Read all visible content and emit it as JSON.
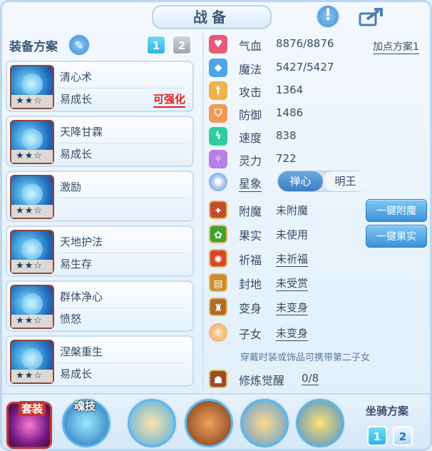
{
  "header": {
    "title": "战备"
  },
  "left": {
    "title": "装备方案",
    "plans": [
      "1",
      "2"
    ],
    "skills": [
      {
        "name": "清心术",
        "sub": "易成长",
        "tag": "可强化",
        "stars": "★★☆"
      },
      {
        "name": "天降甘霖",
        "sub": "易成长",
        "tag": "",
        "stars": "★★☆"
      },
      {
        "name": "激励",
        "sub": "",
        "tag": "",
        "stars": "★★☆"
      },
      {
        "name": "天地护法",
        "sub": "易生存",
        "tag": "",
        "stars": "★★☆"
      },
      {
        "name": "群体净心",
        "sub": "愤怒",
        "tag": "",
        "stars": "★★☆"
      },
      {
        "name": "涅槃重生",
        "sub": "易成长",
        "tag": "",
        "stars": "★★☆"
      }
    ]
  },
  "right": {
    "plan_link": "加点方案1",
    "stats": [
      {
        "label": "气血",
        "value": "8876/8876",
        "color": "#e85a7a",
        "icon": "heart-icon",
        "glyph": "♥"
      },
      {
        "label": "魔法",
        "value": "5427/5427",
        "color": "#4aa6e8",
        "icon": "mana-icon",
        "glyph": "◆"
      },
      {
        "label": "攻击",
        "value": "1364",
        "color": "#f0b34a",
        "icon": "sword-icon",
        "glyph": "†"
      },
      {
        "label": "防御",
        "value": "1486",
        "color": "#f09a5a",
        "icon": "shield-icon",
        "glyph": "⛉"
      },
      {
        "label": "速度",
        "value": "838",
        "color": "#2ccf9a",
        "icon": "speed-icon",
        "glyph": "ϟ"
      },
      {
        "label": "灵力",
        "value": "722",
        "color": "#b77fe8",
        "icon": "spirit-icon",
        "glyph": "✧"
      }
    ],
    "star_label": "星象",
    "toggle": {
      "left": "禅心",
      "right": "明王"
    },
    "extras": [
      {
        "label": "附魔",
        "value": "未附魔",
        "underline": false,
        "icon": "enchant-icon"
      },
      {
        "label": "果实",
        "value": "未使用",
        "underline": false,
        "icon": "fruit-icon"
      },
      {
        "label": "祈福",
        "value": "未祈福",
        "underline": true,
        "icon": "bless-icon"
      },
      {
        "label": "封地",
        "value": "未受赏",
        "underline": true,
        "icon": "fief-icon"
      },
      {
        "label": "变身",
        "value": "未变身",
        "underline": true,
        "icon": "transform-icon"
      },
      {
        "label": "子女",
        "value": "未变身",
        "underline": true,
        "icon": "child-icon"
      }
    ],
    "actions": {
      "enchant": "一键附魔",
      "fruit": "一键果实"
    },
    "note": "穿戴时装或饰品可携带第二子女",
    "cultivate": {
      "label": "修炼觉醒",
      "value": "0/8"
    }
  },
  "bottom": {
    "suit_label": "套装",
    "soul_label": "魂技",
    "mount_label": "坐骑方案",
    "mount_plans": [
      "1",
      "2"
    ]
  }
}
